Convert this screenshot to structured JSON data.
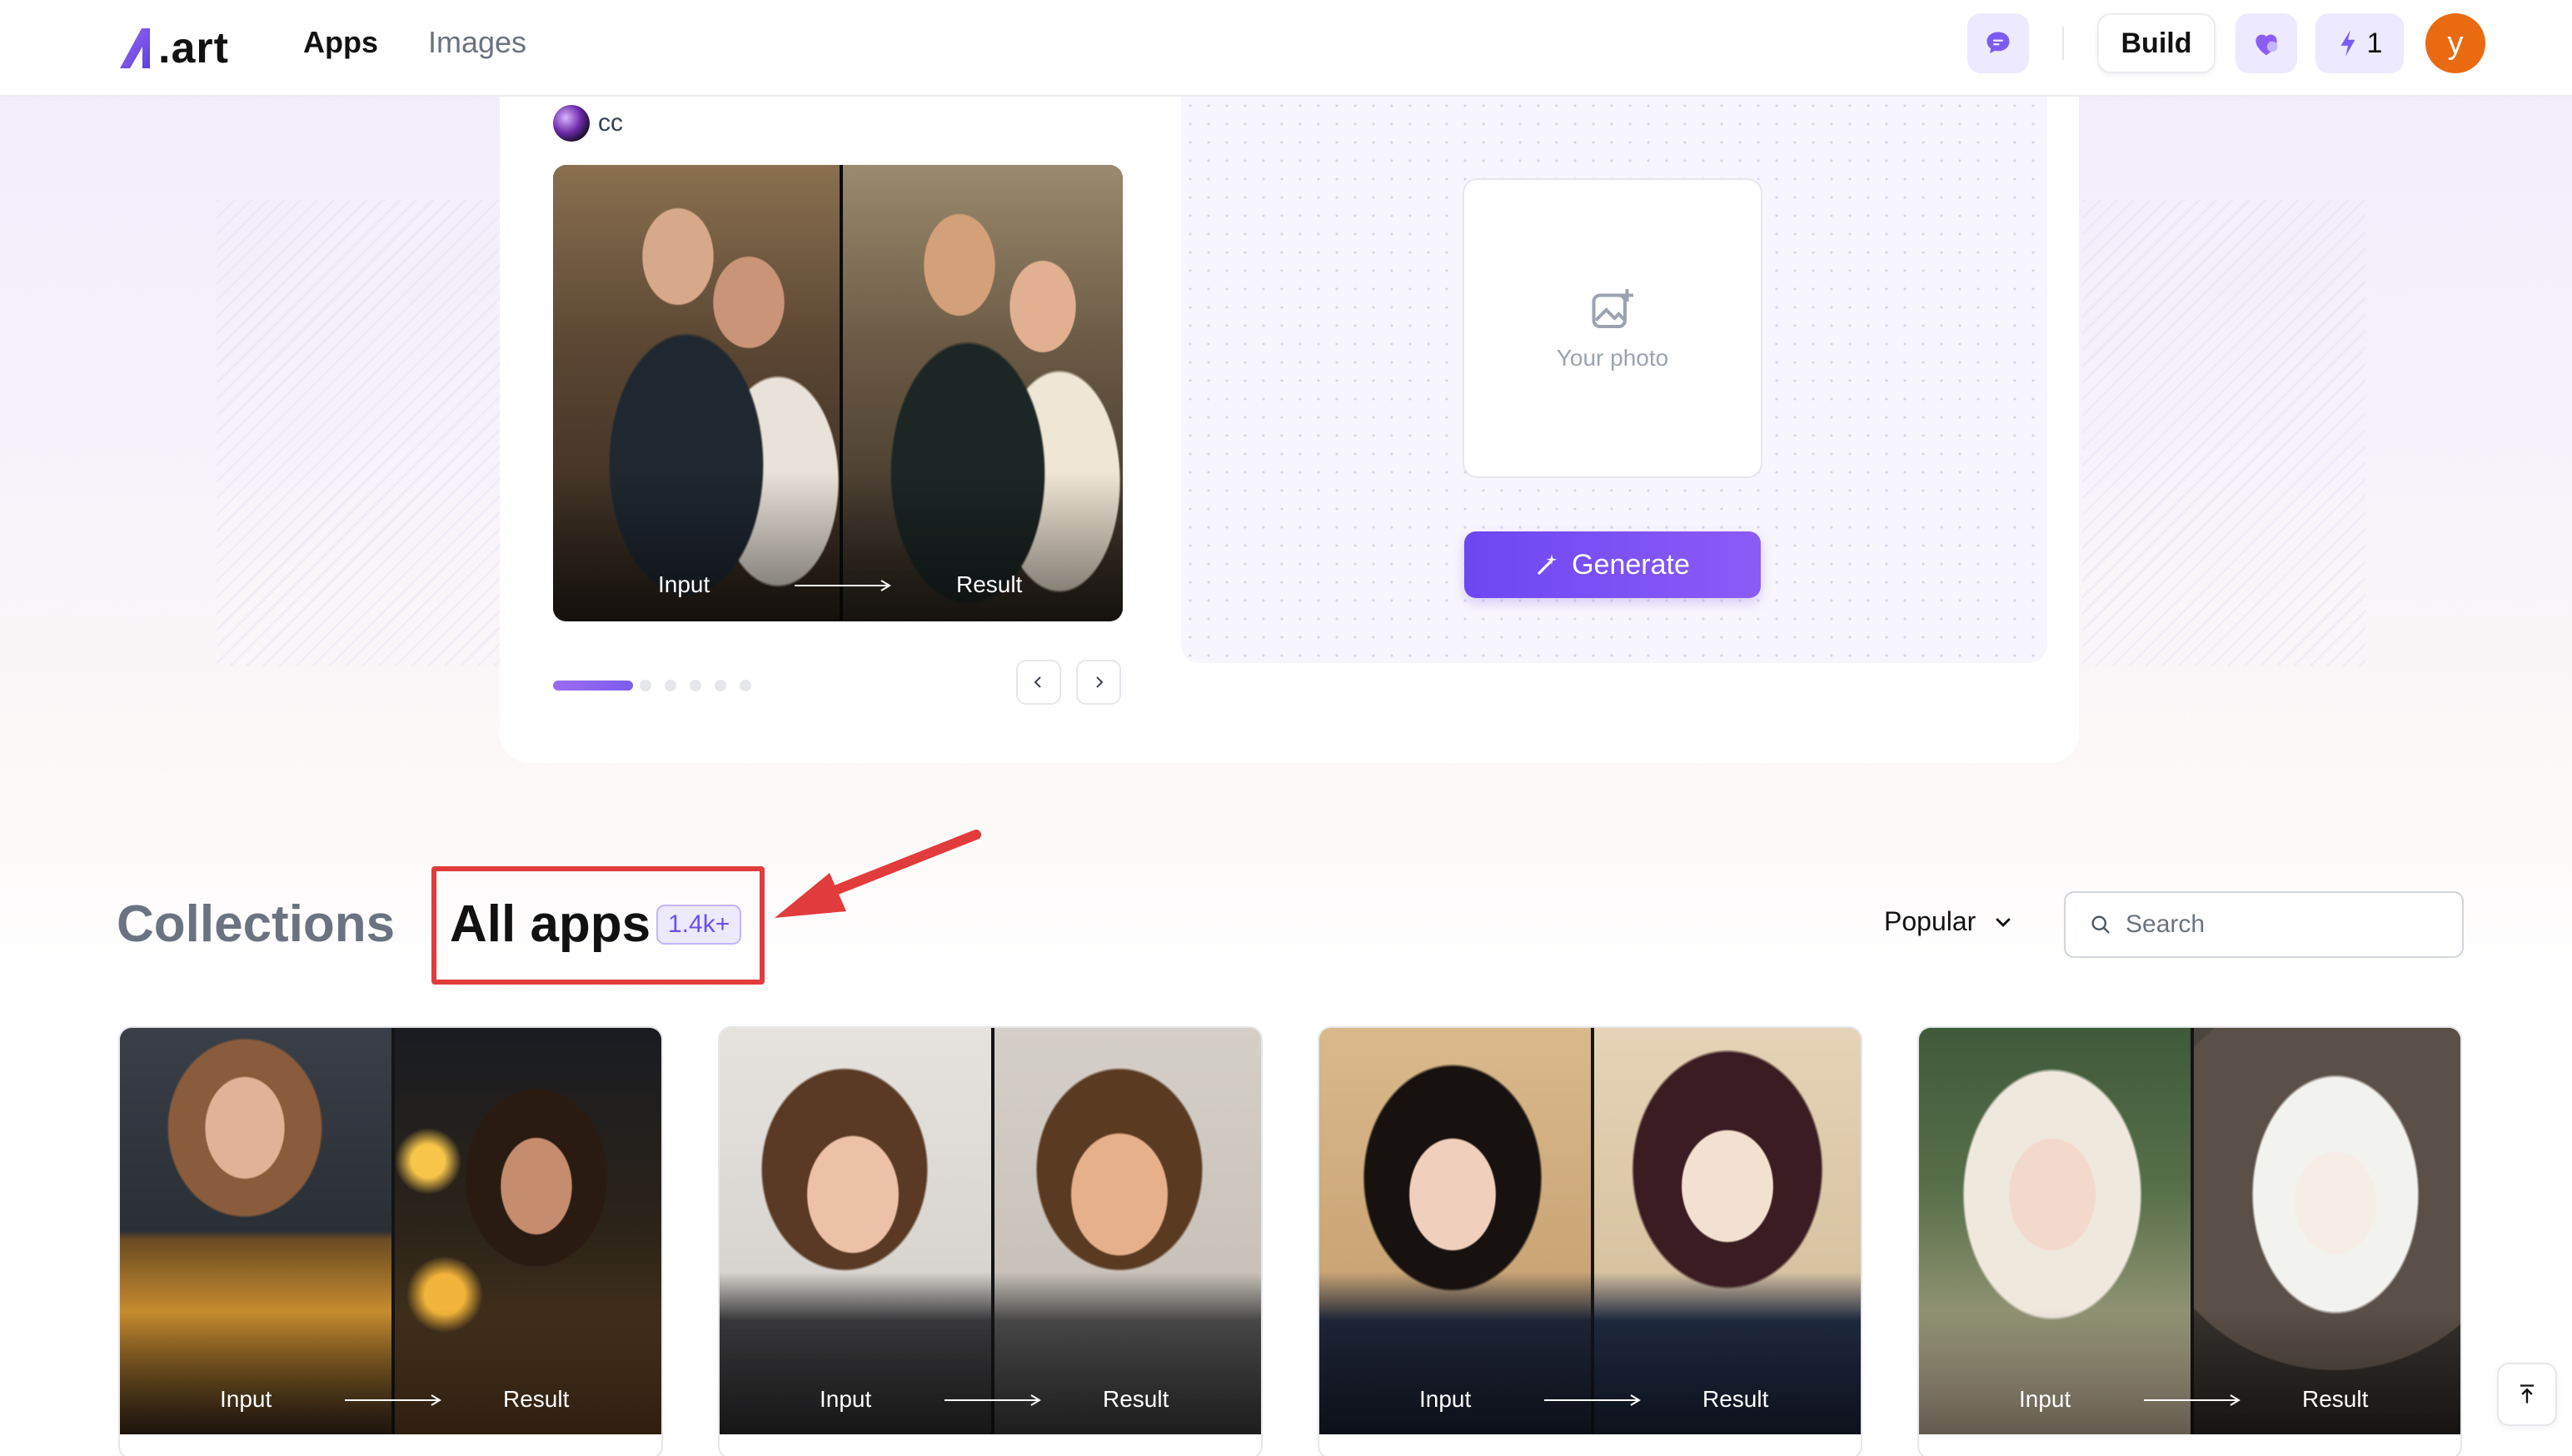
{
  "header": {
    "logo_text": ".art",
    "nav": {
      "apps": "Apps",
      "images": "Images"
    },
    "build_label": "Build",
    "credits": "1",
    "avatar_initial": "y",
    "icons": [
      "chat-bubble-icon",
      "heart-icon",
      "lightning-icon"
    ]
  },
  "featured": {
    "creator": "cc",
    "demo": {
      "input_label": "Input",
      "result_label": "Result"
    },
    "carousel": {
      "slides": 5,
      "active": 1
    },
    "upload": {
      "label": "Your photo"
    },
    "generate_label": "Generate"
  },
  "collections": {
    "tabs": {
      "collections": "Collections",
      "all_apps": "All apps"
    },
    "count": "1.4k+",
    "sort": {
      "selected": "Popular"
    },
    "search": {
      "placeholder": "Search",
      "value": ""
    }
  },
  "cards": [
    {
      "input_label": "Input",
      "result_label": "Result"
    },
    {
      "input_label": "Input",
      "result_label": "Result"
    },
    {
      "input_label": "Input",
      "result_label": "Result"
    },
    {
      "input_label": "Input",
      "result_label": "Result"
    }
  ],
  "colors": {
    "accent": "#7c5cf0",
    "highlight": "#e23b3b",
    "avatar": "#ea6a12"
  }
}
